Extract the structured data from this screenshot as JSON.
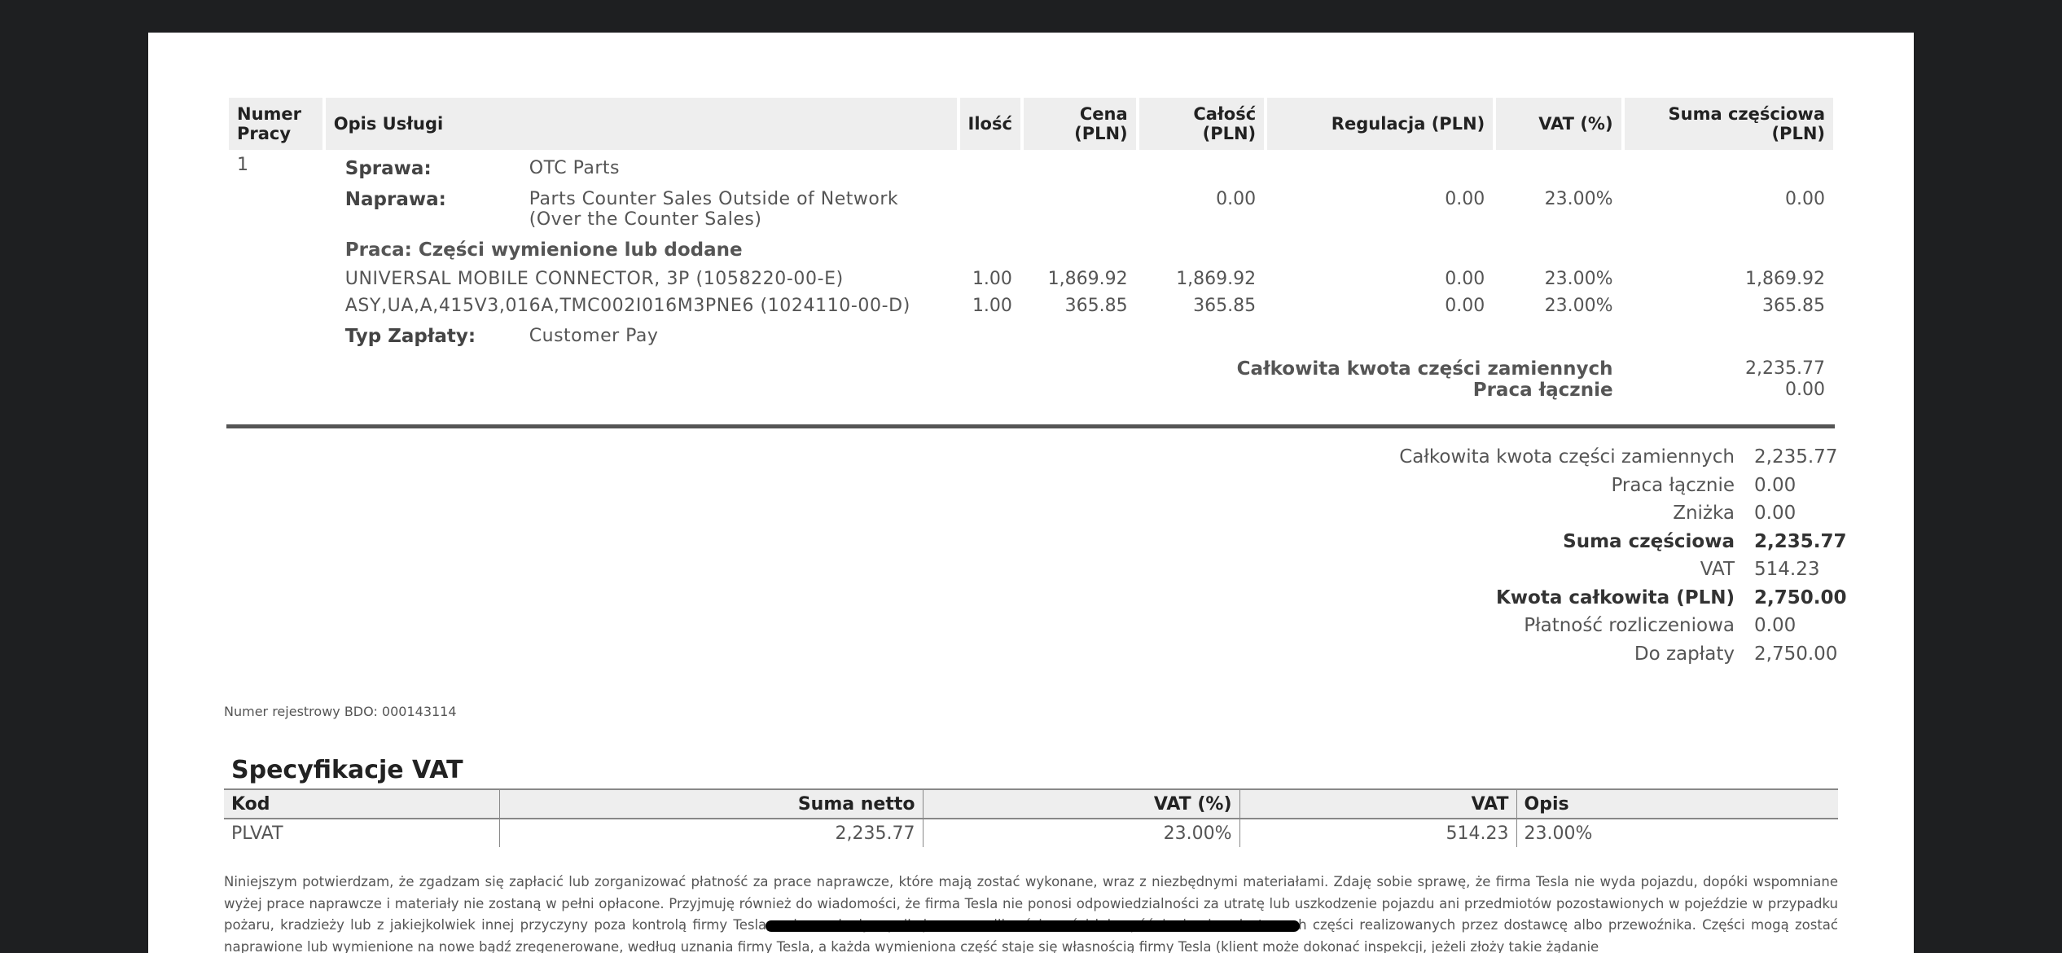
{
  "table": {
    "headers": {
      "num": "Numer Pracy",
      "desc": "Opis Usługi",
      "qty": "Ilość",
      "price": "Cena (PLN)",
      "total": "Całość (PLN)",
      "adj": "Regulacja (PLN)",
      "vat": "VAT (%)",
      "subtotal": "Suma częściowa (PLN)"
    },
    "job_number": "1",
    "case_label": "Sprawa:",
    "case_value": "OTC Parts",
    "repair_label": "Naprawa:",
    "repair_value_line1": "Parts Counter Sales Outside of Network",
    "repair_value_line2": "(Over the Counter Sales)",
    "repair_total": "0.00",
    "repair_adj": "0.00",
    "repair_vat": "23.00%",
    "repair_subtotal": "0.00",
    "labor_heading": "Praca: Części wymienione lub dodane",
    "parts": [
      {
        "desc": "UNIVERSAL MOBILE CONNECTOR, 3P (1058220-00-E)",
        "qty": "1.00",
        "price": "1,869.92",
        "total": "1,869.92",
        "adj": "0.00",
        "vat": "23.00%",
        "subtotal": "1,869.92"
      },
      {
        "desc": "ASY,UA,A,415V3,016A,TMC002I016M3PNE6 (1024110-00-D)",
        "qty": "1.00",
        "price": "365.85",
        "total": "365.85",
        "adj": "0.00",
        "vat": "23.00%",
        "subtotal": "365.85"
      }
    ],
    "pay_label": "Typ Zapłaty:",
    "pay_value": "Customer Pay",
    "parts_total_label": "Całkowita kwota części zamiennych",
    "parts_total_value": "2,235.77",
    "labor_total_label": "Praca łącznie",
    "labor_total_value": "0.00"
  },
  "summary": [
    {
      "label": "Całkowita kwota części zamiennych",
      "value": "2,235.77"
    },
    {
      "label": "Praca łącznie",
      "value": "0.00"
    },
    {
      "label": "Zniżka",
      "value": "0.00"
    },
    {
      "label": "Suma częściowa",
      "value": "2,235.77"
    },
    {
      "label": "VAT",
      "value": "514.23"
    },
    {
      "label": "Kwota całkowita (PLN)",
      "value": "2,750.00"
    },
    {
      "label": "Płatność rozliczeniowa",
      "value": "0.00"
    },
    {
      "label": "Do zapłaty",
      "value": "2,750.00"
    }
  ],
  "bdo": "Numer rejestrowy BDO: 000143114",
  "vat_spec": {
    "title": "Specyfikacje VAT",
    "headers": {
      "code": "Kod",
      "net": "Suma netto",
      "rate": "VAT (%)",
      "vat": "VAT",
      "desc": "Opis"
    },
    "row": {
      "code": "PLVAT",
      "net": "2,235.77",
      "rate": "23.00%",
      "vat": "514.23",
      "desc": "23.00%"
    }
  },
  "disclaimer": "Niniejszym potwierdzam, że zgadzam się zapłacić lub zorganizować płatność za prace naprawcze, które mają zostać wykonane, wraz z niezbędnymi materiałami. Zdaję sobie sprawę, że firma Tesla nie wyda pojazdu, dopóki wspomniane wyżej prace naprawcze i materiały nie zostaną w pełni opłacone. Przyjmuję również do wiadomości, że firma Tesla nie ponosi odpowiedzialności za utratę lub uszkodzenie pojazdu ani przedmiotów pozostawionych w pojeździe w przypadku pożaru, kradzieży lub z jakiejkolwiek innej przyczyny poza kontrolą firmy Tesla, ani za szkody wynikające z wadliwości części lub opóźnieniami w dostawach części realizowanych przez dostawcę albo przewoźnika. Części mogą zostać naprawione lub wymienione na nowe bądź zregenerowane, według uznania firmy Tesla, a każda wymieniona część staje się własnością firmy Tesla (klient może dokonać inspekcji, jeżeli złoży takie żądanie"
}
